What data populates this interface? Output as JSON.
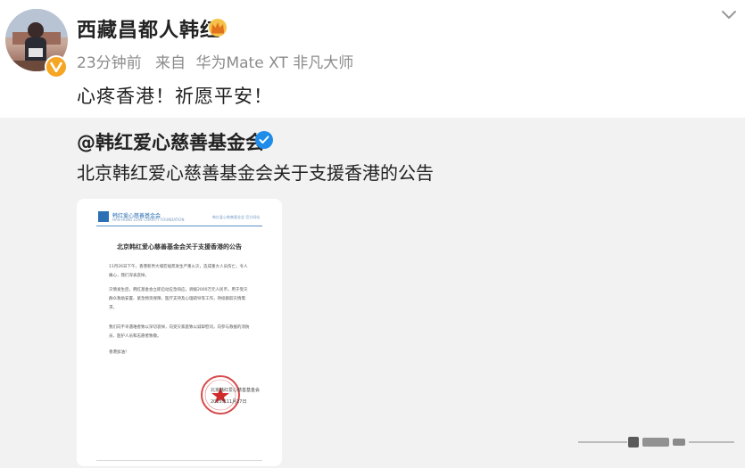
{
  "post": {
    "username": "西藏昌都人韩红",
    "time": "23分钟前",
    "source_prefix": "来自",
    "device": "华为Mate XT 非凡大师",
    "text": "心疼香港！祈愿平安！"
  },
  "repost": {
    "author": "@韩红爱心慈善基金会",
    "text": "北京韩红爱心慈善基金会关于支援香港的公告",
    "document": {
      "org_name": "韩红爱心慈善基金会",
      "org_name_en": "HAN HONG LOVE CHARITY FOUNDATION",
      "header_right": "韩红爱心慈善基金会 官方网站",
      "title": "北京韩红爱心慈善基金会关于支援香港的公告",
      "paragraphs": [
        "11月26日下午，香港新界大埔宏福苑发生严重火灾，造成重大人员伤亡，令人痛心，我们深表哀悼。",
        "灾情发生后，韩红基金会立即启动应急响应，调拨2000万元人民币，用于受灾群众救助安置、紧急物资保障、医疗支持及心理疏导等工作，持续跟踪灾情需求。",
        "我们向不幸遇难者致以深切哀悼，向受灾家庭致以诚挚慰问，向参与救援的消防员、医护人员和志愿者致敬。",
        "香港加油！"
      ],
      "signature": "北京韩红爱心慈善基金会",
      "date": "2025年11月27日"
    }
  },
  "icons": {
    "verified_badge": "orange-verified-v",
    "crown": "gold-crown",
    "repost_verified": "blue-check",
    "chevron": "chevron-down"
  },
  "colors": {
    "header_bg": "#ffffff",
    "repost_bg": "#f2f2f2",
    "meta_text": "#8c8c8c",
    "verified_orange": "#f5a623",
    "verified_blue": "#1e8ce8",
    "seal_red": "#d02a2a"
  }
}
